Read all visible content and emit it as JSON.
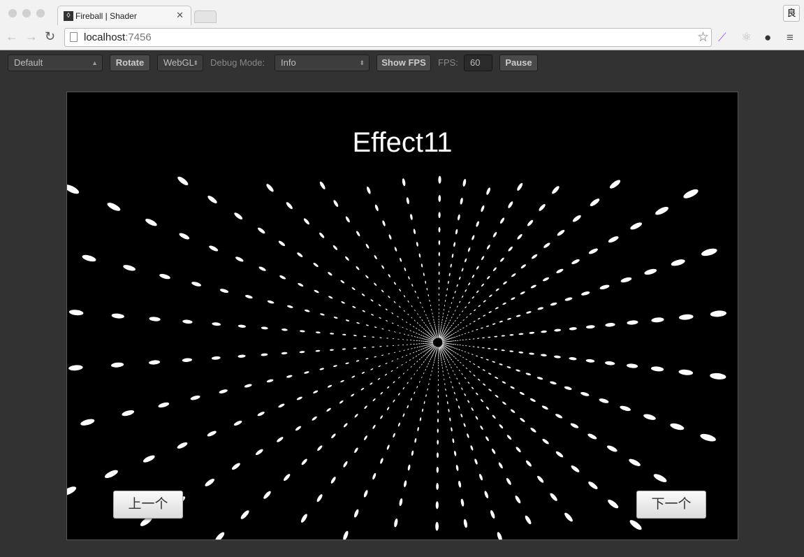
{
  "browser": {
    "tab_title": "Fireball | Shader",
    "url_host": "localhost",
    "url_port": ":7456",
    "extension_label": "良"
  },
  "toolbar": {
    "scene_select": "Default",
    "rotate_label": "Rotate",
    "renderer_select": "WebGL",
    "debug_mode_label": "Debug Mode:",
    "debug_mode_select": "Info",
    "show_fps_label": "Show FPS",
    "fps_label": "FPS:",
    "fps_value": "60",
    "pause_label": "Pause"
  },
  "canvas": {
    "title": "Effect11",
    "prev_label": "上一个",
    "next_label": "下一个",
    "background": "#000000",
    "dot_color": "#ffffff"
  }
}
